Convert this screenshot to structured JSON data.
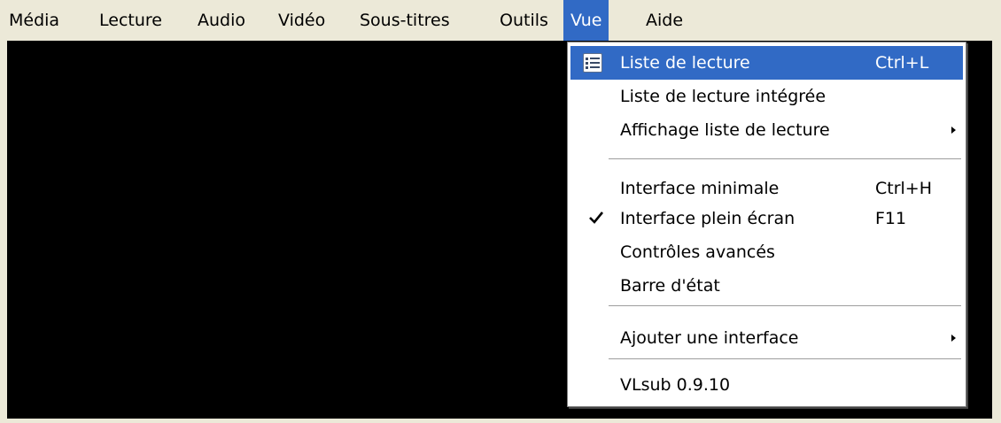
{
  "menubar": {
    "items": [
      {
        "label": "Média"
      },
      {
        "label": "Lecture"
      },
      {
        "label": "Audio"
      },
      {
        "label": "Vidéo"
      },
      {
        "label": "Sous-titres"
      },
      {
        "label": "Outils"
      },
      {
        "label": "Vue",
        "active": true
      },
      {
        "label": "Aide"
      }
    ]
  },
  "dropdown": {
    "items": [
      {
        "label": "Liste de lecture",
        "shortcut": "Ctrl+L",
        "icon": "playlist-icon",
        "highlighted": true
      },
      {
        "label": "Liste de lecture intégrée"
      },
      {
        "label": "Affichage liste de lecture",
        "submenu": true
      },
      {
        "label": "Interface minimale",
        "shortcut": "Ctrl+H"
      },
      {
        "label": "Interface plein écran",
        "shortcut": "F11",
        "checked": true
      },
      {
        "label": "Contrôles avancés"
      },
      {
        "label": "Barre d'état"
      },
      {
        "label": "Ajouter une interface",
        "submenu": true
      },
      {
        "label": "VLsub 0.9.10"
      }
    ]
  },
  "colors": {
    "highlight": "#316ac5",
    "menubar_bg": "#ece9d8",
    "video_bg": "#000000"
  }
}
